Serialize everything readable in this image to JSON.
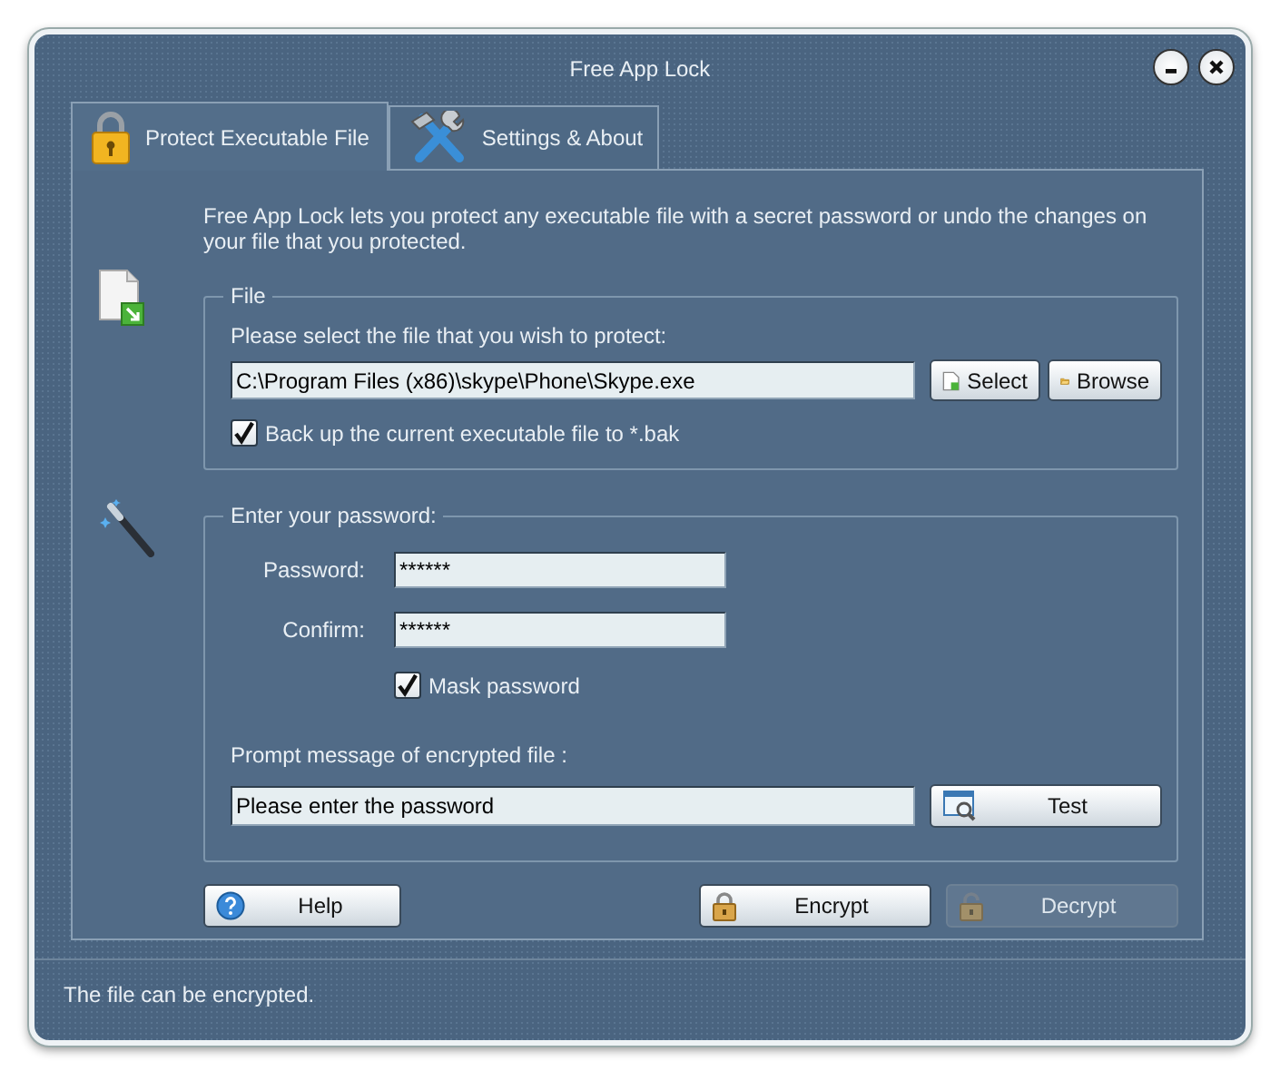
{
  "window": {
    "title": "Free App Lock"
  },
  "tabs": [
    {
      "label": "Protect Executable File",
      "selected": true,
      "kind": "lock"
    },
    {
      "label": "Settings & About",
      "selected": false,
      "kind": "tools"
    }
  ],
  "description": "Free App Lock lets you protect any executable file with a secret password or undo the changes on your file that you protected.",
  "file_group": {
    "legend": "File",
    "prompt": "Please select the file that you wish to protect:",
    "path": {
      "value": "C:\\Program Files (x86)\\skype\\Phone\\Skype.exe"
    },
    "buttons": [
      {
        "label": "Select",
        "kind": "document"
      },
      {
        "label": "Browse",
        "kind": "folder"
      }
    ],
    "backup": {
      "label": "Back up the current executable file to *.bak",
      "checked": true
    }
  },
  "password_group": {
    "legend": "Enter your password:",
    "fields": [
      {
        "label": "Password:",
        "value": "******"
      },
      {
        "label": "Confirm:",
        "value": "******"
      }
    ],
    "mask": {
      "label": "Mask password",
      "checked": true
    },
    "message_label": "Prompt message of encrypted file :",
    "message": {
      "value": "Please enter the password"
    },
    "test_button": {
      "label": "Test"
    }
  },
  "actions": [
    {
      "label": "Help",
      "kind": "help",
      "disabled": false
    },
    {
      "label": "Encrypt",
      "kind": "lock",
      "disabled": false
    },
    {
      "label": "Decrypt",
      "kind": "unlock",
      "disabled": true
    }
  ],
  "status_bar": "The file can be encrypted."
}
